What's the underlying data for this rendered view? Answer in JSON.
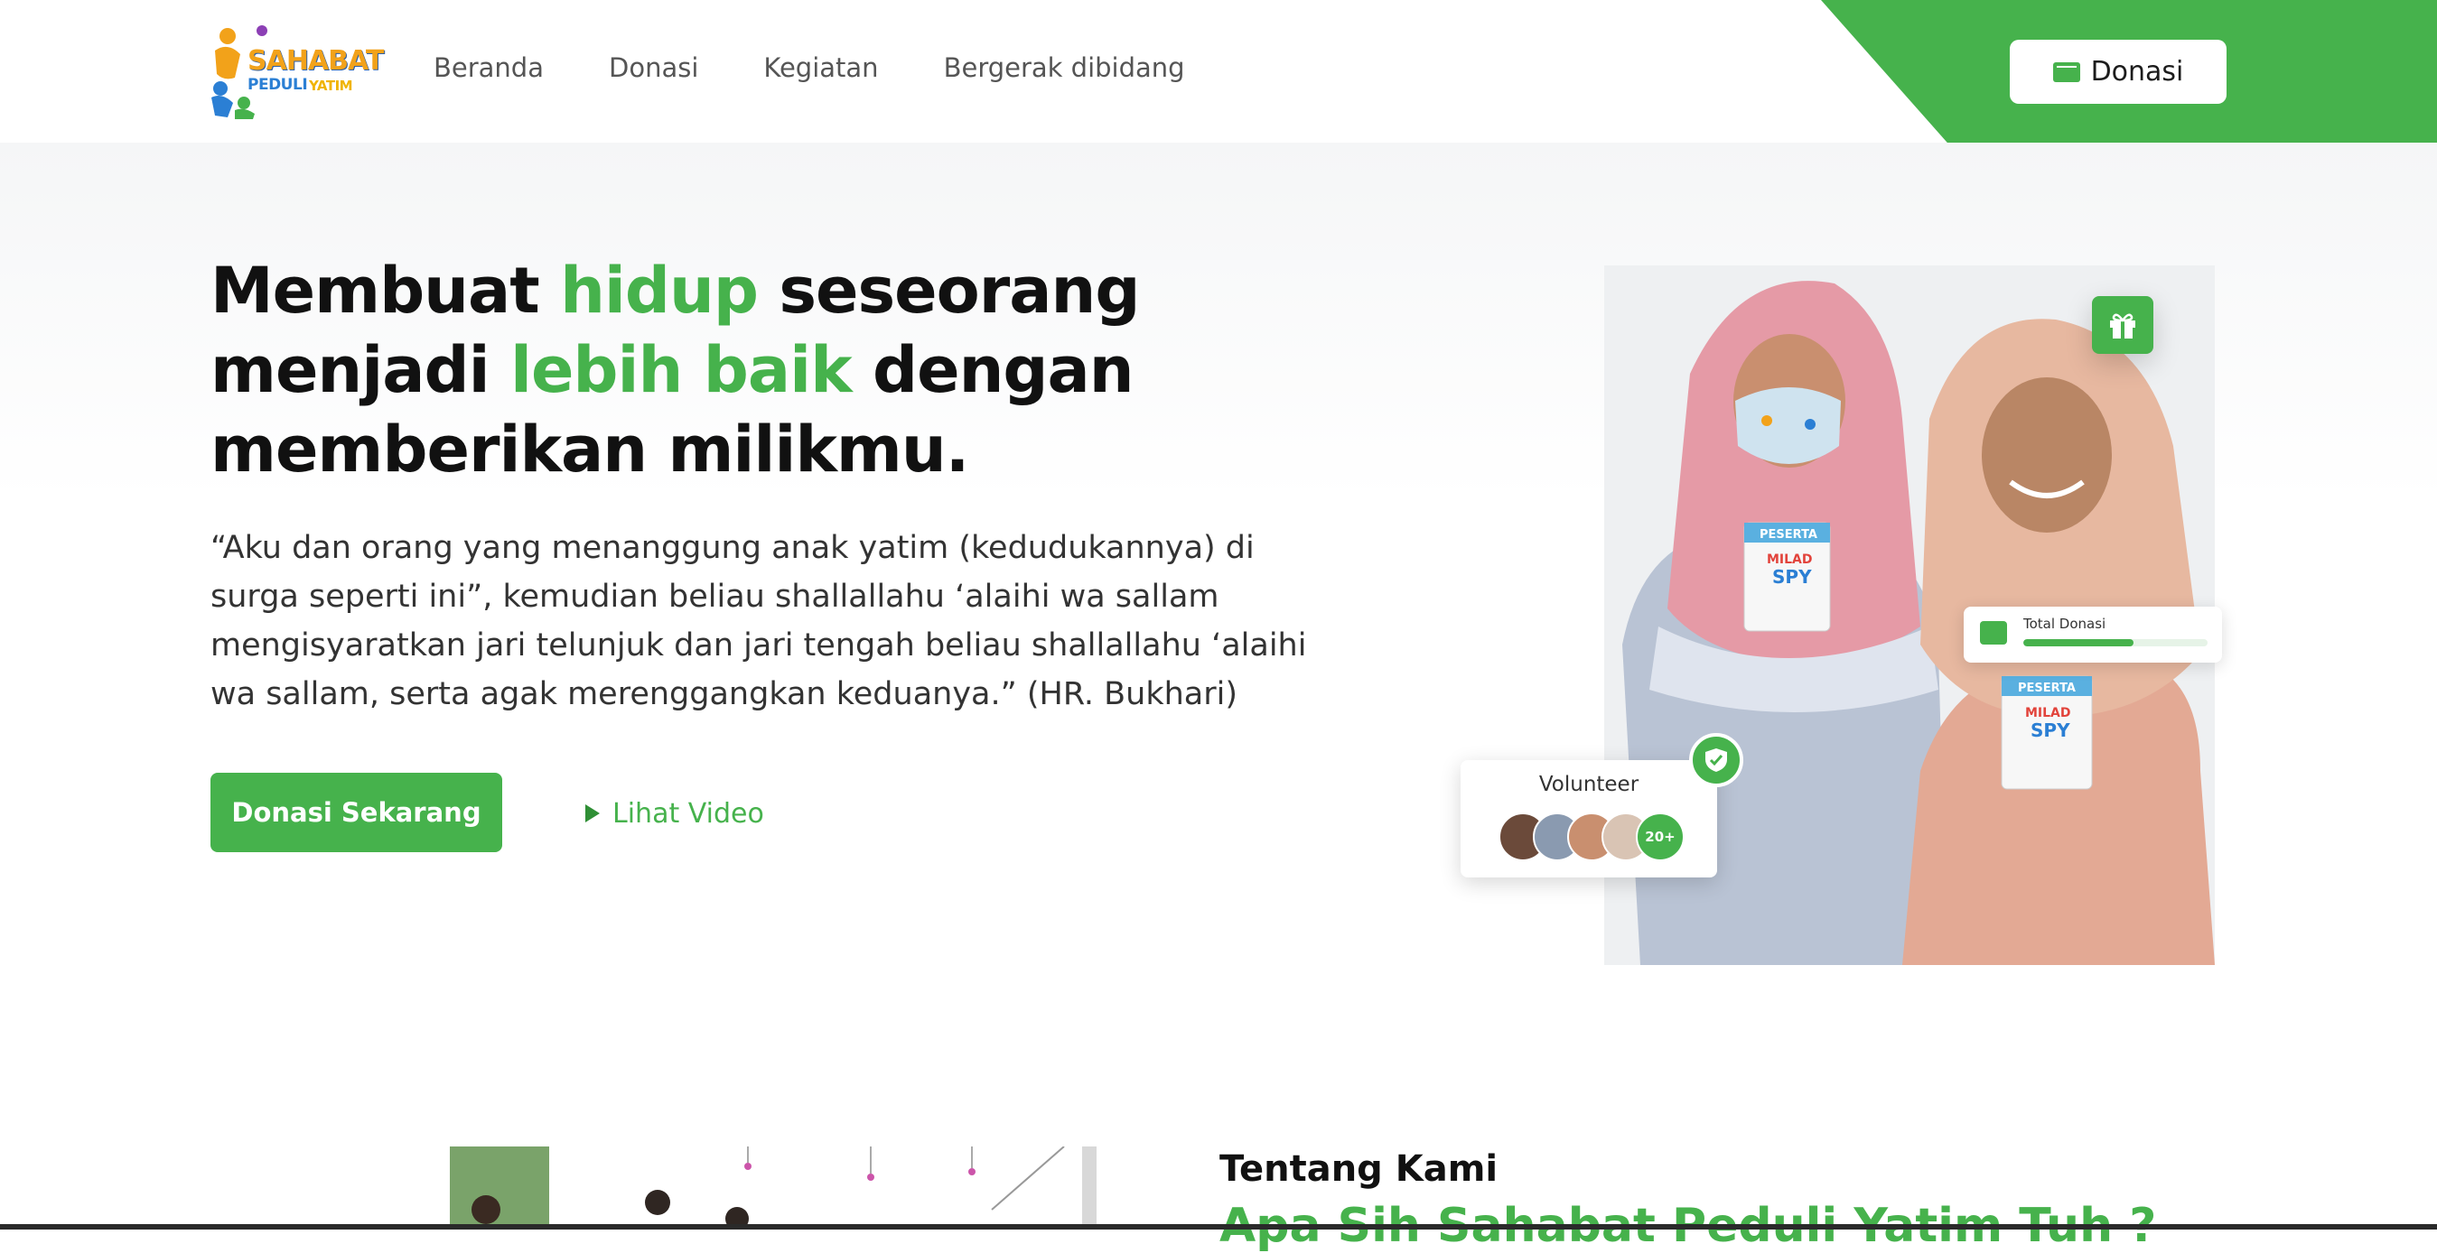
{
  "brand": {
    "logo_line1": "SAHABAT",
    "logo_line2": "PEDULI",
    "logo_line3": "YATIM",
    "accent_color": "#46b24c"
  },
  "nav": {
    "items": [
      {
        "label": "Beranda"
      },
      {
        "label": "Donasi"
      },
      {
        "label": "Kegiatan"
      },
      {
        "label": "Bergerak dibidang"
      }
    ],
    "cta_label": "Donasi",
    "cta_icon": "wallet-icon"
  },
  "hero": {
    "title_part1": "Membuat ",
    "title_hl1": "hidup",
    "title_part2": " seseorang menjadi ",
    "title_hl2": "lebih baik",
    "title_part3": " dengan memberikan milikmu.",
    "quote": "“Aku dan orang yang menanggung anak yatim (kedudukannya) di surga seperti ini”, kemudian beliau shallallahu ‘alaihi wa sallam mengisyaratkan jari telunjuk dan jari tengah beliau shallallahu ‘alaihi wa sallam, serta agak merenggangkan keduanya.” (HR. Bukhari)",
    "primary_button": "Donasi Sekarang",
    "video_button": "Lihat Video",
    "total_donasi_label": "Total Donasi",
    "total_donasi_progress": 0.6,
    "volunteer_label": "Volunteer",
    "volunteer_more": "20+",
    "badge_label_1": "PESERTA",
    "badge_label_2": "MILAD",
    "badge_label_3": "SPY"
  },
  "about": {
    "title": "Tentang Kami",
    "subtitle": "Apa Sih Sahabat Peduli Yatim Tuh ?"
  }
}
